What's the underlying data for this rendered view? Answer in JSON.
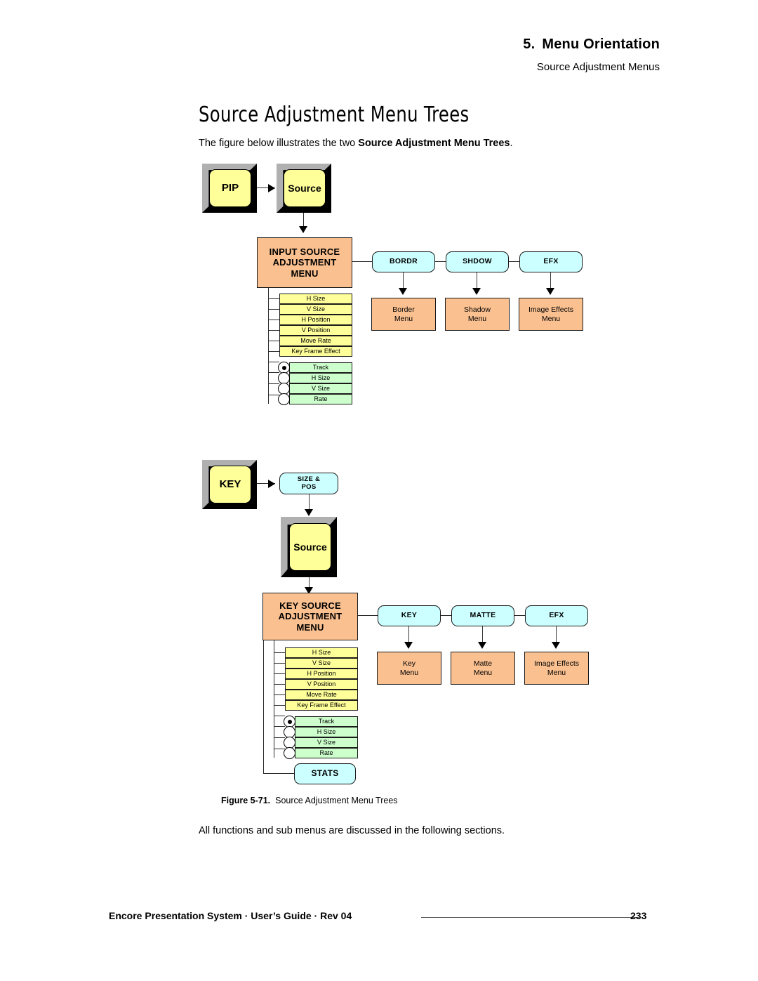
{
  "header": {
    "chapter_number": "5.",
    "chapter_title": "Menu Orientation",
    "subtitle": "Source Adjustment Menus"
  },
  "section": {
    "heading": "Source Adjustment Menu Trees",
    "intro_before": "The figure below illustrates the two ",
    "intro_bold": "Source Adjustment Menu Trees",
    "intro_after": "."
  },
  "figure": {
    "caption_label": "Figure 5-71.",
    "caption_text": "Source Adjustment Menu Trees",
    "colors": {
      "hardware_key": "#FFFF99",
      "menu_button": "#CCFFFF",
      "menu_box": "#FAC090",
      "list_yellow": "#FFFF99",
      "list_green": "#CCFFCC"
    },
    "tree1": {
      "keys": [
        {
          "label": "PIP"
        },
        {
          "label": "Source"
        }
      ],
      "root_menu": "INPUT SOURCE ADJUSTMENT MENU",
      "root_menu_lines": [
        "INPUT SOURCE",
        "ADJUSTMENT",
        "MENU"
      ],
      "buttons": [
        {
          "label": "BORDR",
          "menu_line1": "Border",
          "menu_line2": "Menu"
        },
        {
          "label": "SHDOW",
          "menu_line1": "Shadow",
          "menu_line2": "Menu"
        },
        {
          "label": "EFX",
          "menu_line1": "Image Effects",
          "menu_line2": "Menu"
        }
      ],
      "params": [
        "H Size",
        "V Size",
        "H Position",
        "V Position",
        "Move Rate",
        "Key Frame Effect"
      ],
      "options": [
        {
          "label": "Track",
          "selected": true
        },
        {
          "label": "H Size",
          "selected": false
        },
        {
          "label": "V Size",
          "selected": false
        },
        {
          "label": "Rate",
          "selected": false
        }
      ]
    },
    "tree2": {
      "keys": [
        {
          "label": "KEY"
        },
        {
          "label": "Source"
        }
      ],
      "size_pos_button_lines": [
        "SIZE &",
        "POS"
      ],
      "root_menu": "KEY SOURCE ADJUSTMENT MENU",
      "root_menu_lines": [
        "KEY SOURCE",
        "ADJUSTMENT",
        "MENU"
      ],
      "buttons": [
        {
          "label": "KEY",
          "menu_line1": "Key",
          "menu_line2": "Menu"
        },
        {
          "label": "MATTE",
          "menu_line1": "Matte",
          "menu_line2": "Menu"
        },
        {
          "label": "EFX",
          "menu_line1": "Image Effects",
          "menu_line2": "Menu"
        }
      ],
      "params": [
        "H Size",
        "V Size",
        "H Position",
        "V Position",
        "Move Rate",
        "Key Frame Effect"
      ],
      "options": [
        {
          "label": "Track",
          "selected": true
        },
        {
          "label": "H Size",
          "selected": false
        },
        {
          "label": "V Size",
          "selected": false
        },
        {
          "label": "Rate",
          "selected": false
        }
      ],
      "stats_button": "STATS"
    }
  },
  "body": {
    "closing_text": "All functions and sub menus are discussed in the following sections."
  },
  "footer": {
    "text": "Encore Presentation System  ·  User’s Guide  ·  Rev 04",
    "page_number": "233"
  }
}
